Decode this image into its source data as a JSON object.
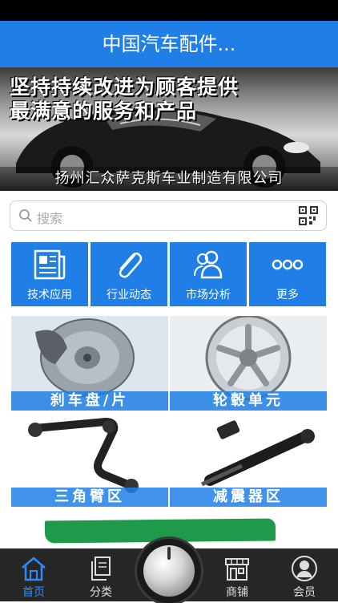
{
  "app": {
    "title": "中国汽车配件..."
  },
  "banner": {
    "slogan_line1": "坚持持续改进为顾客提供",
    "slogan_line2": "最满意的服务和产品",
    "company": "扬州汇众萨克斯车业制造有限公司"
  },
  "search": {
    "placeholder": "搜索",
    "icon": "search-icon",
    "scan_icon": "qr-code-icon"
  },
  "quick_links": [
    {
      "label": "技术应用",
      "icon": "newspaper-icon"
    },
    {
      "label": "行业动态",
      "icon": "paperclip-icon"
    },
    {
      "label": "市场分析",
      "icon": "users-icon"
    },
    {
      "label": "更多",
      "icon": "more-dots-icon"
    }
  ],
  "products": [
    {
      "label": "刹车盘/片",
      "icon": "brake-disc-image"
    },
    {
      "label": "轮毂单元",
      "icon": "wheel-rim-image"
    },
    {
      "label": "三角臂区",
      "icon": "control-arm-image"
    },
    {
      "label": "减震器区",
      "icon": "shock-absorber-image"
    }
  ],
  "tabs": [
    {
      "label": "首页",
      "icon": "home-icon",
      "active": true
    },
    {
      "label": "分类",
      "icon": "document-copy-icon",
      "active": false
    },
    {
      "label": "商铺",
      "icon": "store-icon",
      "active": false
    },
    {
      "label": "会员",
      "icon": "user-icon",
      "active": false
    }
  ],
  "colors": {
    "primary": "#1f7fe6",
    "tab_bar": "#262626",
    "tab_active": "#2a8cff",
    "strip": "#1e9a4a"
  }
}
